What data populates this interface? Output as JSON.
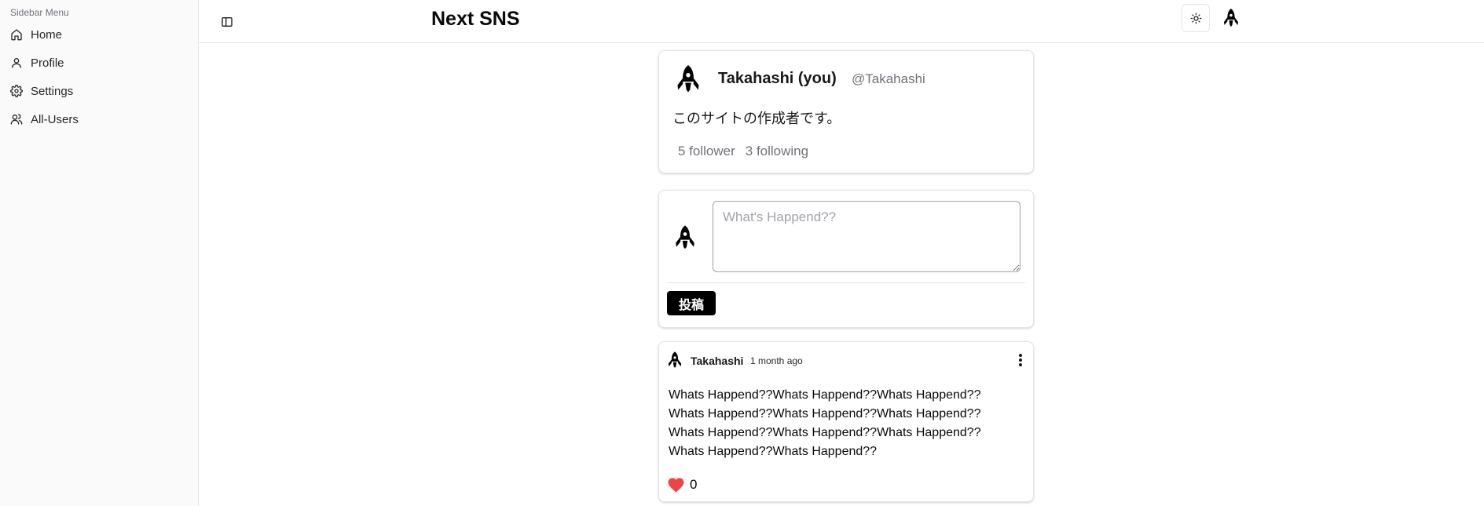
{
  "sidebar": {
    "group_label": "Sidebar Menu",
    "items": [
      {
        "label": "Home",
        "icon": "home-icon"
      },
      {
        "label": "Profile",
        "icon": "user-icon"
      },
      {
        "label": "Settings",
        "icon": "gear-icon"
      },
      {
        "label": "All-Users",
        "icon": "users-icon"
      }
    ]
  },
  "header": {
    "title": "Next SNS",
    "toggle_icon": "sidebar-toggle-icon",
    "theme_icon": "sun-icon",
    "avatar_icon": "rocket-icon"
  },
  "profile": {
    "name": "Takahashi (you)",
    "handle": "@Takahashi",
    "bio": "このサイトの作成者です。",
    "followers": "5 follower",
    "following": "3 following"
  },
  "compose": {
    "placeholder": "What's Happend??",
    "value": "",
    "button_label": "投稿"
  },
  "posts": [
    {
      "author": "Takahashi",
      "time": "1 month ago",
      "body_lines": [
        "Whats Happend??Whats Happend??Whats Happend??",
        "Whats Happend??Whats Happend??Whats Happend??",
        "Whats Happend??Whats Happend??Whats Happend??",
        "Whats Happend??Whats Happend??"
      ],
      "likes": "0",
      "like_icon": "heart-icon",
      "menu_icon": "more-vertical-icon"
    }
  ],
  "colors": {
    "accent": "#000000",
    "heart": "#ef4444",
    "muted": "#71717a",
    "border": "#e4e4e7",
    "sidebar_bg": "#fafafa"
  }
}
